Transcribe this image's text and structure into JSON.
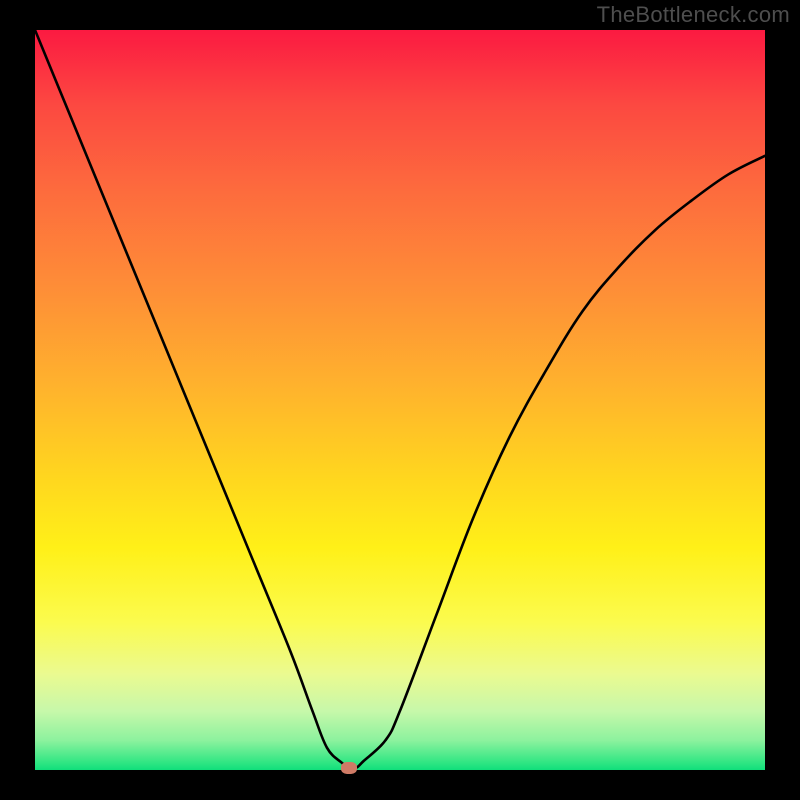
{
  "watermark": "TheBottleneck.com",
  "chart_data": {
    "type": "line",
    "title": "",
    "xlabel": "",
    "ylabel": "",
    "xlim": [
      0,
      100
    ],
    "ylim": [
      0,
      100
    ],
    "background_gradient": {
      "top": "#fb1a41",
      "bottom": "#10df7b",
      "stops": [
        "#fb1a41",
        "#fc4841",
        "#fd6c3d",
        "#fe8e37",
        "#ffb22d",
        "#ffd51f",
        "#fff018",
        "#fbfb4e",
        "#ebfa90",
        "#c7f8aa",
        "#8cf29e",
        "#30e683",
        "#10df7b"
      ]
    },
    "series": [
      {
        "name": "bottleneck-curve",
        "color": "#000000",
        "x": [
          0,
          5,
          10,
          15,
          20,
          25,
          30,
          35,
          38,
          40,
          42,
          43,
          44,
          45,
          48,
          50,
          55,
          60,
          65,
          70,
          75,
          80,
          85,
          90,
          95,
          100
        ],
        "y": [
          100,
          88,
          76,
          64,
          52,
          40,
          28,
          16,
          8,
          3,
          1,
          0.3,
          0.3,
          1.2,
          4,
          8,
          21,
          34,
          45,
          54,
          62,
          68,
          73,
          77,
          80.5,
          83
        ]
      }
    ],
    "minimum_point": {
      "x": 43,
      "y": 0.3
    },
    "colors": {
      "curve": "#000000",
      "marker": "#cf7b66",
      "frame": "#000000"
    }
  }
}
